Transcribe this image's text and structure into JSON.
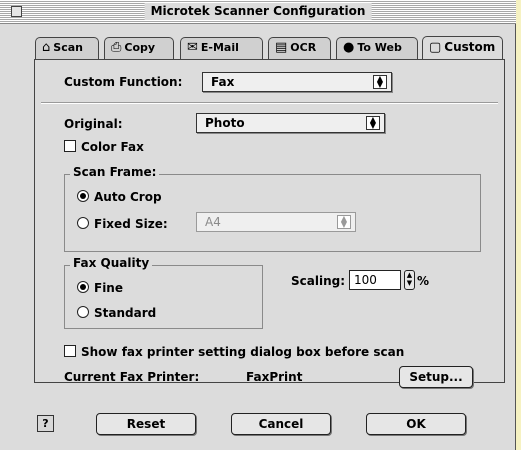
{
  "window": {
    "title": "Microtek Scanner Configuration"
  },
  "tabs": [
    {
      "label": "Scan",
      "icon": "scan-icon",
      "glyph": "⌂"
    },
    {
      "label": "Copy",
      "icon": "printer-icon",
      "glyph": "⎙"
    },
    {
      "label": "E-Mail",
      "icon": "mail-icon",
      "glyph": "✉"
    },
    {
      "label": "OCR",
      "icon": "ocr-icon",
      "glyph": "▤"
    },
    {
      "label": "To Web",
      "icon": "globe-icon",
      "glyph": "●"
    },
    {
      "label": "Custom",
      "icon": "custom-icon",
      "glyph": "▢"
    }
  ],
  "custom": {
    "function_label": "Custom Function:",
    "function_value": "Fax",
    "original_label": "Original:",
    "original_value": "Photo",
    "color_fax_label": "Color Fax",
    "scan_frame": {
      "title": "Scan Frame:",
      "auto_crop": "Auto Crop",
      "fixed_size": "Fixed Size:",
      "fixed_size_value": "A4"
    },
    "fax_quality": {
      "title": "Fax Quality",
      "fine": "Fine",
      "standard": "Standard"
    },
    "scaling_label": "Scaling:",
    "scaling_value": "100",
    "scaling_unit": "%",
    "show_dialog_label": "Show fax printer setting dialog box before scan",
    "current_printer_label": "Current Fax Printer:",
    "current_printer_value": "FaxPrint",
    "setup_button": "Setup..."
  },
  "footer": {
    "help": "?",
    "reset": "Reset",
    "cancel": "Cancel",
    "ok": "OK"
  },
  "state": {
    "active_tab": "Custom",
    "color_fax_checked": false,
    "scan_frame_selected": "Auto Crop",
    "fax_quality_selected": "Fine",
    "show_dialog_checked": false
  },
  "colors": {
    "desktop": "#f6f2c2",
    "window": "#dcdcdc"
  }
}
